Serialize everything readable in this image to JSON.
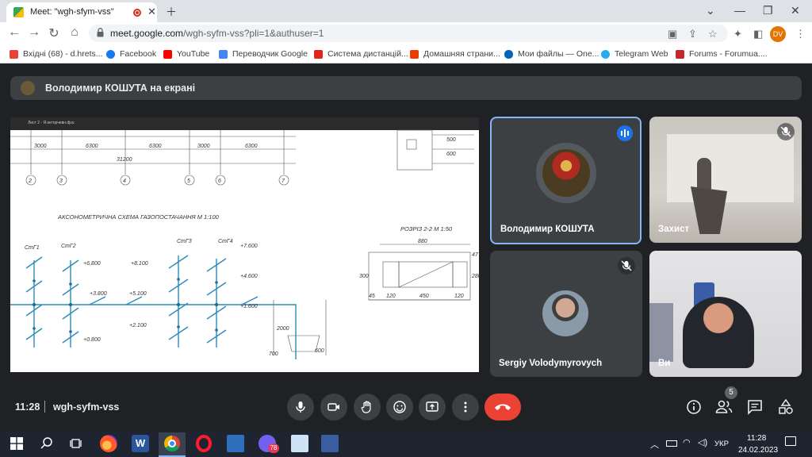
{
  "browser": {
    "tab_title": "Meet: \"wgh-sfym-vss\"",
    "url_host": "meet.google.com",
    "url_path": "/wgh-syfm-vss?pli=1&authuser=1",
    "profile_initials": "DV",
    "bookmarks": [
      "Вхідні (68) - d.hrets...",
      "Facebook",
      "YouTube",
      "Переводчик Google",
      "Система дистанцій...",
      "Домашняя страни...",
      "Мои файлы — One...",
      "Telegram Web",
      "Forums - Forumua...."
    ]
  },
  "meet": {
    "presenting_text": "Володимир КОШУТА на екрані",
    "participants": [
      {
        "name": "Володимир КОШУТА",
        "speaking": true
      },
      {
        "name": "Захист",
        "muted": true
      },
      {
        "name": "Sergiy Volodymyrovych",
        "muted": true
      },
      {
        "name": "Ви"
      }
    ],
    "time": "11:28",
    "meeting_code": "wgh-syfm-vss",
    "people_count": "5"
  },
  "drawing": {
    "title": "Лист 2 - Я.екторчевн.djvu",
    "dimensions_top": [
      "3000",
      "6300",
      "6300",
      "3000",
      "6300"
    ],
    "dimension_total": "31200",
    "axes": [
      "2",
      "3",
      "4",
      "5",
      "6",
      "7"
    ],
    "scheme_title": "АКСОНОМЕТРИЧНА СХЕМА ГАЗОПОСТАЧАННЯ  М 1:100",
    "section_title": "РОЗРІЗ 2-2 М 1:50",
    "risers": [
      "СтГ1",
      "СтГ2",
      "СтГ3",
      "СтГ4"
    ],
    "levels": [
      "+6.800",
      "+8.100",
      "+7.600",
      "+4.600",
      "+3.800",
      "+5.100",
      "+1.600",
      "+2.100",
      "+0.800"
    ],
    "section_dims": [
      "880",
      "120",
      "450",
      "120",
      "45",
      "300",
      "280",
      "2000",
      "700",
      "600",
      "500",
      "600",
      "47"
    ]
  },
  "taskbar": {
    "time": "11:28",
    "date": "24.02.2023",
    "lang": "УКР",
    "viber_badge": "78"
  },
  "colors": {
    "meet_bg": "#202124",
    "tile_bg": "#3c4043",
    "active_border": "#8ab4f8",
    "end_call": "#ea4335",
    "speaking_badge": "#1a73e8"
  }
}
